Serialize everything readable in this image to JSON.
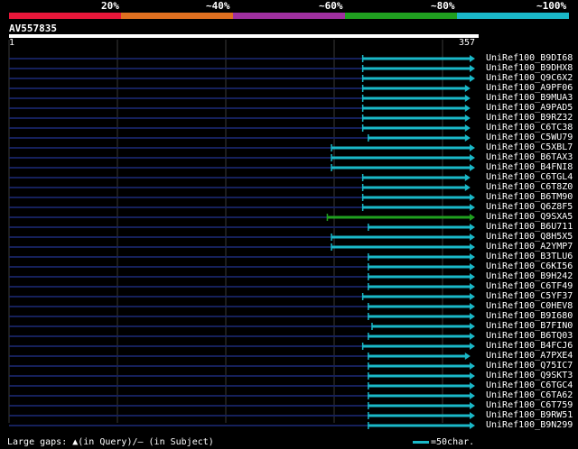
{
  "legend": {
    "labels": [
      "20%",
      "~40%",
      "~60%",
      "~80%",
      "~100%"
    ],
    "colors": [
      "#e8173a",
      "#e07020",
      "#a030a0",
      "#20a020",
      "#1ab8c8"
    ]
  },
  "query": {
    "name": "AV557835",
    "start": "1",
    "end": "357"
  },
  "hits": [
    {
      "name": "UniRef100_B9DI68",
      "start": 0.759,
      "end": 1.0,
      "color": "#1ab8c8"
    },
    {
      "name": "UniRef100_B9DHX8",
      "start": 0.759,
      "end": 1.0,
      "color": "#1ab8c8"
    },
    {
      "name": "UniRef100_Q9C6X2",
      "start": 0.759,
      "end": 1.0,
      "color": "#1ab8c8"
    },
    {
      "name": "UniRef100_A9PF06",
      "start": 0.759,
      "end": 0.99,
      "color": "#1ab8c8"
    },
    {
      "name": "UniRef100_B9MUA3",
      "start": 0.759,
      "end": 0.99,
      "color": "#1ab8c8"
    },
    {
      "name": "UniRef100_A9PAD5",
      "start": 0.759,
      "end": 0.99,
      "color": "#1ab8c8"
    },
    {
      "name": "UniRef100_B9RZ32",
      "start": 0.759,
      "end": 0.99,
      "color": "#1ab8c8"
    },
    {
      "name": "UniRef100_C6TC38",
      "start": 0.759,
      "end": 0.99,
      "color": "#1ab8c8"
    },
    {
      "name": "UniRef100_C5WU79",
      "start": 0.771,
      "end": 0.99,
      "color": "#1ab8c8"
    },
    {
      "name": "UniRef100_C5XBL7",
      "start": 0.692,
      "end": 1.0,
      "color": "#1ab8c8"
    },
    {
      "name": "UniRef100_B6TAX3",
      "start": 0.692,
      "end": 1.0,
      "color": "#1ab8c8"
    },
    {
      "name": "UniRef100_B4FNI8",
      "start": 0.692,
      "end": 1.0,
      "color": "#1ab8c8"
    },
    {
      "name": "UniRef100_C6TGL4",
      "start": 0.759,
      "end": 0.99,
      "color": "#1ab8c8"
    },
    {
      "name": "UniRef100_C6T8Z0",
      "start": 0.759,
      "end": 0.99,
      "color": "#1ab8c8"
    },
    {
      "name": "UniRef100_B6TM90",
      "start": 0.759,
      "end": 1.0,
      "color": "#1ab8c8"
    },
    {
      "name": "UniRef100_Q6Z8F5",
      "start": 0.759,
      "end": 1.0,
      "color": "#1ab8c8"
    },
    {
      "name": "UniRef100_Q9SXA5",
      "start": 0.683,
      "end": 1.0,
      "color": "#20a020"
    },
    {
      "name": "UniRef100_B6U711",
      "start": 0.771,
      "end": 1.0,
      "color": "#1ab8c8"
    },
    {
      "name": "UniRef100_Q8H5X5",
      "start": 0.692,
      "end": 1.0,
      "color": "#1ab8c8"
    },
    {
      "name": "UniRef100_A2YMP7",
      "start": 0.692,
      "end": 1.0,
      "color": "#1ab8c8"
    },
    {
      "name": "UniRef100_B3TLU6",
      "start": 0.771,
      "end": 1.0,
      "color": "#1ab8c8"
    },
    {
      "name": "UniRef100_C6KI56",
      "start": 0.771,
      "end": 1.0,
      "color": "#1ab8c8"
    },
    {
      "name": "UniRef100_B9H242",
      "start": 0.771,
      "end": 1.0,
      "color": "#1ab8c8"
    },
    {
      "name": "UniRef100_C6TF49",
      "start": 0.771,
      "end": 1.0,
      "color": "#1ab8c8"
    },
    {
      "name": "UniRef100_C5YF37",
      "start": 0.759,
      "end": 1.0,
      "color": "#1ab8c8"
    },
    {
      "name": "UniRef100_C0HEV8",
      "start": 0.771,
      "end": 1.0,
      "color": "#1ab8c8"
    },
    {
      "name": "UniRef100_B9I680",
      "start": 0.771,
      "end": 1.0,
      "color": "#1ab8c8"
    },
    {
      "name": "UniRef100_B7FIN0",
      "start": 0.779,
      "end": 1.0,
      "color": "#1ab8c8"
    },
    {
      "name": "UniRef100_B6TQ03",
      "start": 0.771,
      "end": 1.0,
      "color": "#1ab8c8"
    },
    {
      "name": "UniRef100_B4FCJ6",
      "start": 0.759,
      "end": 1.0,
      "color": "#1ab8c8"
    },
    {
      "name": "UniRef100_A7PXE4",
      "start": 0.771,
      "end": 0.99,
      "color": "#1ab8c8"
    },
    {
      "name": "UniRef100_Q75IC7",
      "start": 0.771,
      "end": 1.0,
      "color": "#1ab8c8"
    },
    {
      "name": "UniRef100_Q9SKT3",
      "start": 0.771,
      "end": 1.0,
      "color": "#1ab8c8"
    },
    {
      "name": "UniRef100_C6TGC4",
      "start": 0.771,
      "end": 1.0,
      "color": "#1ab8c8"
    },
    {
      "name": "UniRef100_C6TA62",
      "start": 0.771,
      "end": 1.0,
      "color": "#1ab8c8"
    },
    {
      "name": "UniRef100_C6T759",
      "start": 0.771,
      "end": 1.0,
      "color": "#1ab8c8"
    },
    {
      "name": "UniRef100_B9RW51",
      "start": 0.771,
      "end": 1.0,
      "color": "#1ab8c8"
    },
    {
      "name": "UniRef100_B9N299",
      "start": 0.771,
      "end": 1.0,
      "color": "#1ab8c8"
    }
  ],
  "colors": {
    "grid": "#3a3a3a",
    "unaligned": "#15205a",
    "query_bar": "#ffffff"
  },
  "footer": {
    "gaps_text": "Large gaps: ▲(in Query)/– (in Subject)",
    "scale_text": "=50char."
  }
}
